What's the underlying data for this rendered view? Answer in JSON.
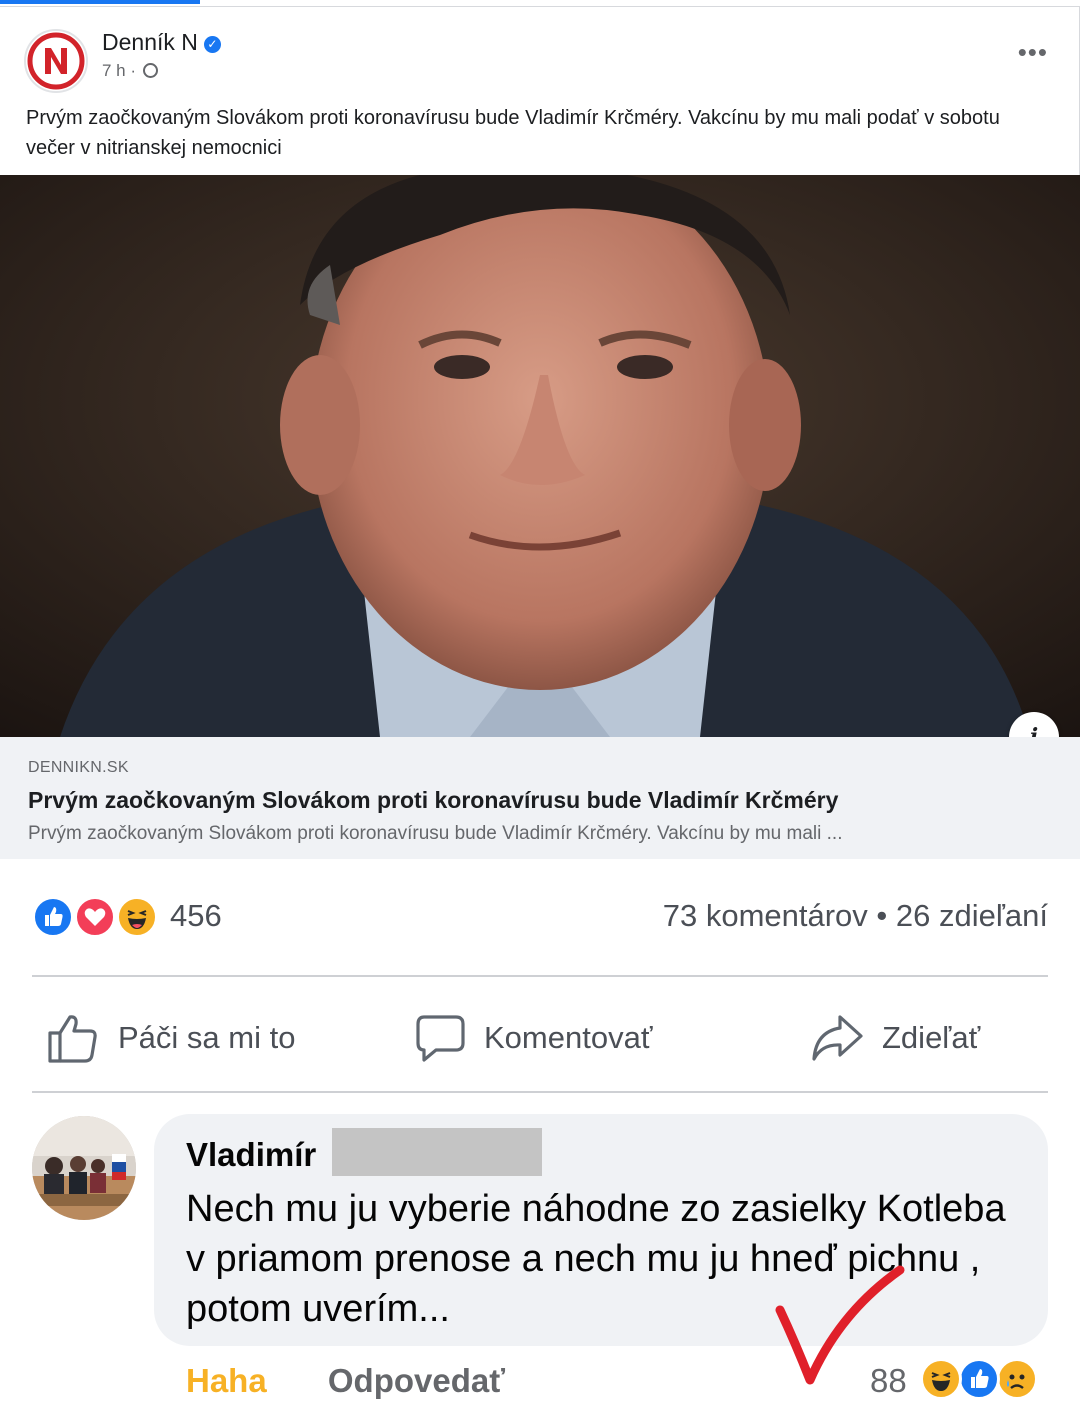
{
  "post": {
    "page_name": "Denník N",
    "logo_letter": "N",
    "time": "7 h ·",
    "text": "Prvým zaočkovaným Slovákom proti koronavírusu bude Vladimír Krčméry. Vakcínu by mu mali podať v sobotu večer v nitrianskej nemocnici",
    "more_icon": "more-dots-icon"
  },
  "link_preview": {
    "domain": "DENNIKN.SK",
    "title": "Prvým zaočkovaným Slovákom proti koronavírusu bude Vladimír Krčméry",
    "description": "Prvým zaočkovaným Slovákom proti koronavírusu bude Vladimír Krčméry. Vakcínu by mu mali ...",
    "info_label": "i"
  },
  "reactions": {
    "icons": [
      "like-reaction-icon",
      "love-reaction-icon",
      "haha-reaction-icon"
    ],
    "count": "456",
    "comments": "73 komentárov",
    "separator": "•",
    "shares": "26 zdieľaní"
  },
  "actions": {
    "like": "Páči sa mi to",
    "comment": "Komentovať",
    "share": "Zdieľať"
  },
  "comment": {
    "author": "Vladimír",
    "text": "Nech mu ju vyberie náhodne zo zasielky Kotleba v priamom prenose a nech mu ju hneď pichnu , potom uverím...",
    "haha_label": "Haha",
    "reply_label": "Odpovedať",
    "reaction_count": "88",
    "reaction_icons": [
      "haha-reaction-icon",
      "like-reaction-icon",
      "sad-reaction-icon"
    ]
  },
  "colors": {
    "facebook_blue": "#1877f2",
    "love_red": "#f33e58",
    "haha_yellow": "#f7b125",
    "secondary_text": "#65676b",
    "bubble_bg": "#f0f2f5",
    "annotation_red": "#e0202a"
  }
}
